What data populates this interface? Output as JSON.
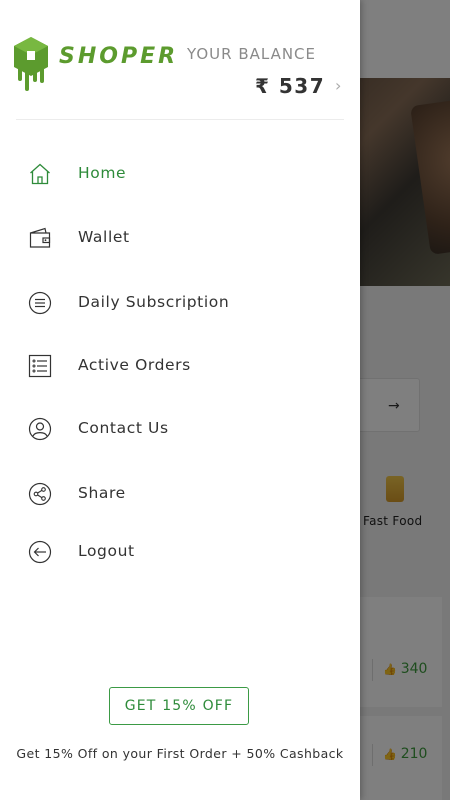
{
  "app": {
    "name": "SHOPER",
    "brand_color": "#5c9b2e"
  },
  "balance": {
    "label": "YOUR BALANCE",
    "value": "₹ 537"
  },
  "menu": [
    {
      "label": "Home",
      "icon": "home-icon",
      "active": true
    },
    {
      "label": "Wallet",
      "icon": "wallet-icon",
      "active": false
    },
    {
      "label": "Daily Subscription",
      "icon": "subscription-icon",
      "active": false
    },
    {
      "label": "Active Orders",
      "icon": "orders-list-icon",
      "active": false
    },
    {
      "label": "Contact Us",
      "icon": "contact-icon",
      "active": false
    },
    {
      "label": "Share",
      "icon": "share-icon",
      "active": false
    },
    {
      "label": "Logout",
      "icon": "logout-icon",
      "active": false
    }
  ],
  "promo": {
    "button_label": "GET 15% OFF",
    "text": "Get 15% Off on your First Order + 50% Cashback"
  },
  "background": {
    "category_label": "Fast Food",
    "likes": [
      "340",
      "210"
    ]
  }
}
